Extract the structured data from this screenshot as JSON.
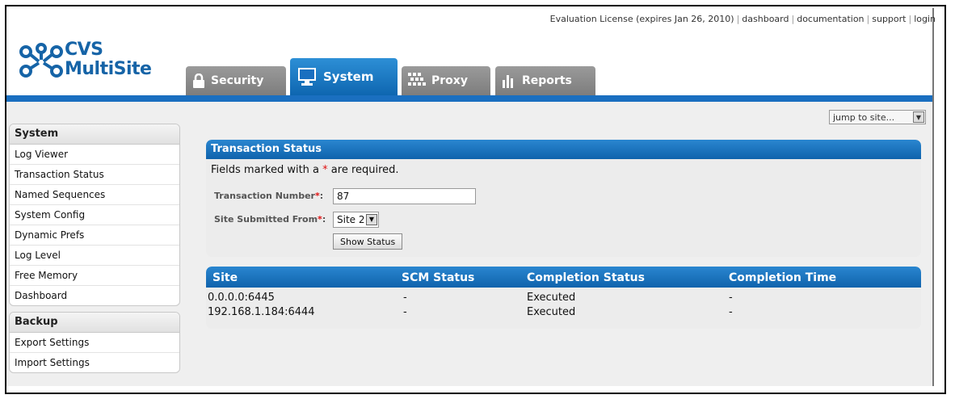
{
  "header": {
    "license_text": "Evaluation License (expires Jan 26, 2010)",
    "links": [
      "dashboard",
      "documentation",
      "support",
      "login"
    ]
  },
  "logo": {
    "line1": "CVS",
    "line2": "MultiSite"
  },
  "tabs": [
    {
      "label": "Security",
      "icon": "lock-icon"
    },
    {
      "label": "System",
      "icon": "monitor-icon",
      "active": true
    },
    {
      "label": "Proxy",
      "icon": "network-icon"
    },
    {
      "label": "Reports",
      "icon": "bar-chart-icon"
    }
  ],
  "jump_select": {
    "value": "jump to site..."
  },
  "sidebar": {
    "system": {
      "title": "System",
      "items": [
        "Log Viewer",
        "Transaction Status",
        "Named Sequences",
        "System Config",
        "Dynamic Prefs",
        "Log Level",
        "Free Memory",
        "Dashboard"
      ]
    },
    "backup": {
      "title": "Backup",
      "items": [
        "Export Settings",
        "Import Settings"
      ]
    }
  },
  "form": {
    "title": "Transaction Status",
    "required_prefix": "Fields marked with a ",
    "required_star": "*",
    "required_suffix": " are required.",
    "txn_label": "Transaction Number",
    "txn_value": "87",
    "site_label": "Site Submitted From",
    "site_value": "Site 2",
    "label_colon": ":",
    "submit_label": "Show Status"
  },
  "table": {
    "columns": [
      "Site",
      "SCM Status",
      "Completion Status",
      "Completion Time"
    ],
    "rows": [
      [
        "0.0.0.0:6445",
        "-",
        "Executed",
        "-"
      ],
      [
        "192.168.1.184:6444",
        "-",
        "Executed",
        "-"
      ]
    ]
  },
  "colors": {
    "accent_blue": "#1a6fc0",
    "tab_gray": "#8a8a8a",
    "logo_blue": "#1664a7",
    "required_red": "#e01010"
  }
}
